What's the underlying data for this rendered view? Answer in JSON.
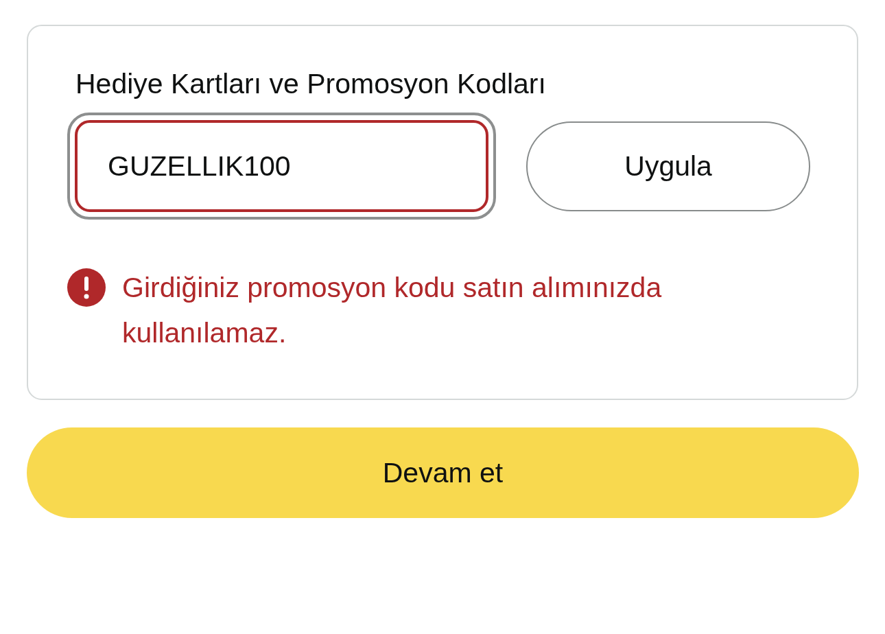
{
  "promo_card": {
    "title": "Hediye Kartları ve Promosyon Kodları",
    "code_field": {
      "value": "GUZELLIK100",
      "invalid": true,
      "focused": true
    },
    "apply_button": "Uygula",
    "error": {
      "message": "Girdiğiniz promosyon kodu satın alımınızda kullanılamaz."
    }
  },
  "continue_button": "Devam et"
}
